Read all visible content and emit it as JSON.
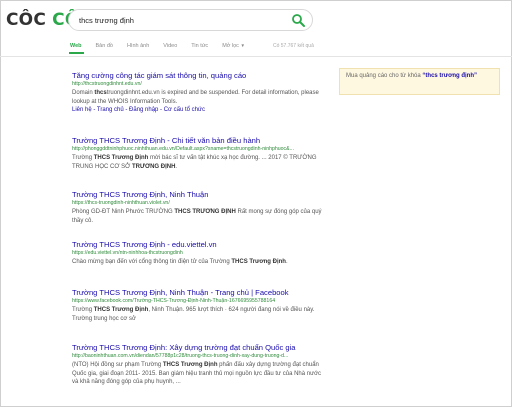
{
  "logo": {
    "part1": "CÔC",
    "part2": "CÔC"
  },
  "search": {
    "query": "thcs trương định"
  },
  "tabs": [
    {
      "label": "Web"
    },
    {
      "label": "Bản đồ"
    },
    {
      "label": "Hình ảnh"
    },
    {
      "label": "Video"
    },
    {
      "label": "Tin tức"
    },
    {
      "label": "Mở lọc"
    }
  ],
  "result_count": "Có 57.767 kết quả",
  "ad_box": {
    "text": "Mua quảng cáo cho từ khóa",
    "keyword": "“thcs trương định”"
  },
  "results": [
    {
      "title": "Tăng cường công tác giám sát thông tin, quảng cáo",
      "url": "http://thcstruongdinhnt.edu.vn/",
      "snippet_pre": "Domain ",
      "snippet_bold": "thcs",
      "snippet_post": "truongdinhnt.edu.vn is expired and be suspended. For detail information, please lookup at the WHOIS Information Tools.",
      "links": "Liên hệ - Trang chủ - Đăng nhập - Cơ cấu tổ chức"
    },
    {
      "title": "Trường THCS Trương Định - Chi tiết văn bản điều hành",
      "url": "http://phonggddtninhphuoc.ninhthuan.edu.vn/Default.aspx?sname=thcstruongdinh-ninhphuoc&...",
      "snippet_pre": "Trường ",
      "snippet_bold": "THCS Trương Định",
      "snippet_post": " mời bác sĩ tư vấn tật khúc xạ học đường. ... 2017 © TRƯỜNG TRUNG HỌC CƠ SỞ ",
      "snippet_bold2": "TRƯƠNG ĐỊNH",
      "snippet_post2": "."
    },
    {
      "title": "Trường THCS Trương Định, Ninh Thuận",
      "url": "https://thcs-truongdinh-ninhthuan.violet.vn/",
      "snippet_pre": "Phòng GD-ĐT Ninh Phước TRƯỜNG ",
      "snippet_bold": "THCS TRƯƠNG ĐỊNH",
      "snippet_post": " Rất mong sự đóng góp của quý thầy cô."
    },
    {
      "title": "Trường THCS Trương Định - edu.viettel.vn",
      "url": "https://edu.viettel.vn/ntn-ninhhoa-thcstruongdinh",
      "snippet_pre": "Chào mừng bạn đến với cổng thông tin điện tử của Trường ",
      "snippet_bold": "THCS Trương Định",
      "snippet_post": "."
    },
    {
      "title": "Trường THCS Trương Định, Ninh Thuận - Trang chủ | Facebook",
      "url": "https://www.facebook.com/Trường-THCS-Trương-Định-Ninh-Thuận-1676695955788164",
      "snippet_pre": "Trường ",
      "snippet_bold": "THCS Trương Định",
      "snippet_post": ", Ninh Thuận. 965 lượt thích · 624 người đang nói về điều này. Trường trung học cơ sở"
    },
    {
      "title": "Trường THCS Trương Định: Xây dựng trường đạt chuẩn Quốc gia",
      "url": "http://baoninhthuan.com.vn/diendan/57788p1c28/truong-thcs-truong-dinh-xay-dung-truong-d...",
      "snippet_pre": "(NTO) Hội đồng sư phạm Trường ",
      "snippet_bold": "THCS Trương Định",
      "snippet_post": " phấn đấu xây dựng trường đạt chuẩn Quốc gia, giai đoạn 2011- 2015. Ban giám hiệu tranh thủ mọi nguồn lực đầu tư của Nhà nước và khả năng đóng góp của phụ huynh, ..."
    }
  ]
}
